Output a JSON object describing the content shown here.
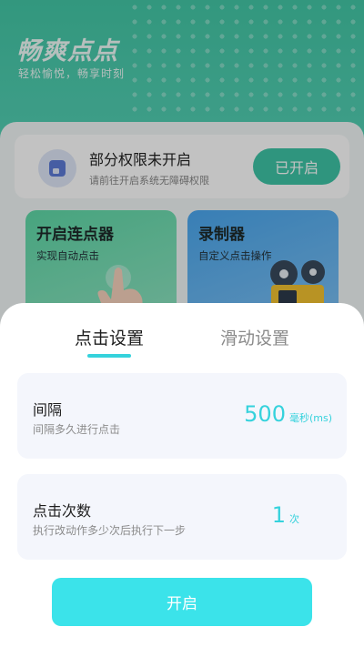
{
  "background": {
    "brand_title": "畅爽点点",
    "brand_subtitle": "轻松愉悦，畅享时刻",
    "permission": {
      "title": "部分权限未开启",
      "desc": "请前往开启系统无障碍权限",
      "button_label": "已开启"
    },
    "features": [
      {
        "title": "开启连点器",
        "subtitle": "实现自动点击"
      },
      {
        "title": "录制器",
        "subtitle": "自定义点击操作"
      }
    ]
  },
  "sheet": {
    "tabs": [
      {
        "label": "点击设置",
        "active": true
      },
      {
        "label": "滑动设置",
        "active": false
      }
    ],
    "interval": {
      "title": "间隔",
      "desc": "间隔多久进行点击",
      "value": "500",
      "unit": "毫秒(ms)"
    },
    "click_count": {
      "title": "点击次数",
      "desc": "执行改动作多少次后执行下一步",
      "value": "1",
      "unit": "次"
    },
    "start_button_label": "开启"
  },
  "colors": {
    "accent": "#35d2dc",
    "start_button": "#3be3ea",
    "header_green": "#43c7a6"
  },
  "icons": [
    "permission-icon",
    "hand-pointer-icon",
    "film-projector-icon"
  ]
}
